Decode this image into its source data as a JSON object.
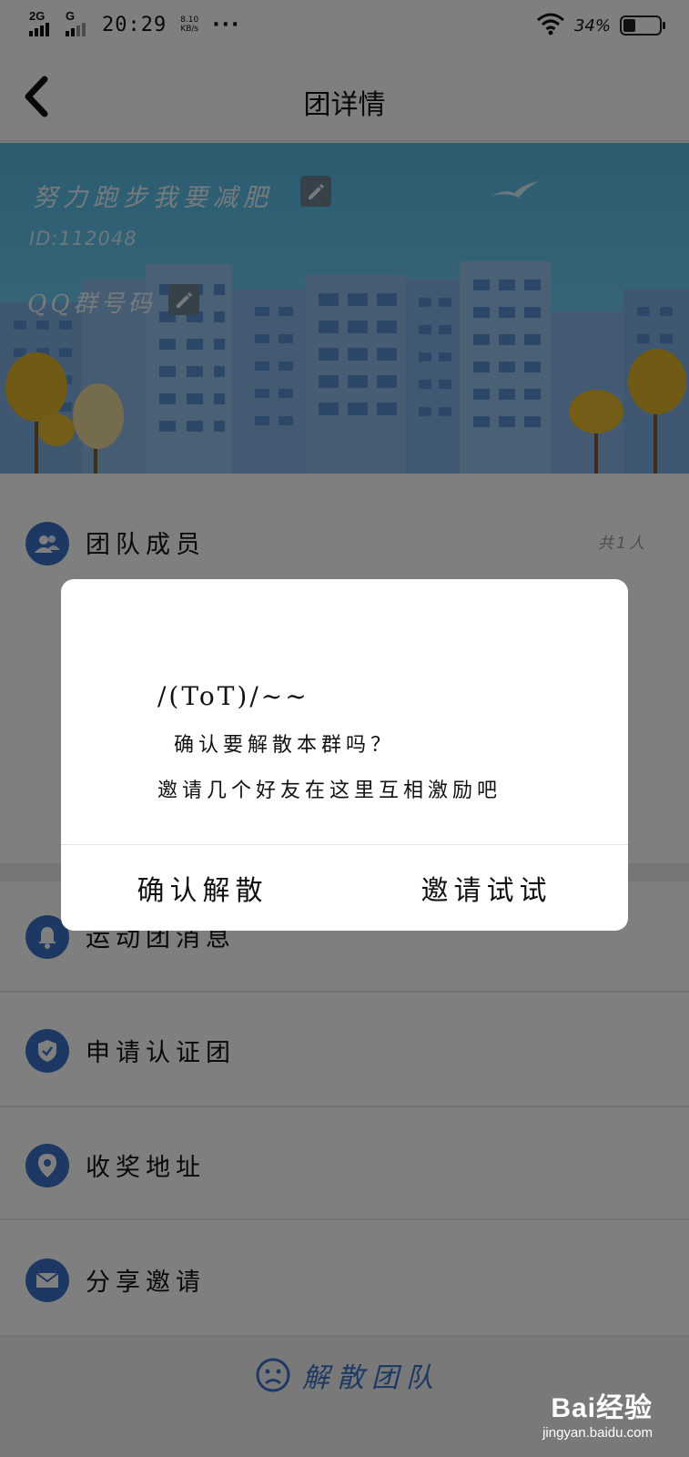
{
  "status_bar": {
    "network1": "2G",
    "network2": "G",
    "time": "20:29",
    "speed_value": "8.10",
    "speed_unit": "KB/s",
    "more": "···",
    "battery_text": "34%",
    "battery_level": 0.34
  },
  "header": {
    "title": "团详情"
  },
  "banner": {
    "team_name": "努力跑步我要减肥",
    "team_id": "ID:112048",
    "qq_label": "QQ群号码"
  },
  "members": {
    "label": "团队成员",
    "count": "共1人"
  },
  "menu": {
    "items": [
      {
        "label": "运动团消息",
        "icon": "bell-icon"
      },
      {
        "label": "申请认证团",
        "icon": "shield-icon"
      },
      {
        "label": "收奖地址",
        "icon": "location-icon"
      },
      {
        "label": "分享邀请",
        "icon": "mail-icon"
      }
    ]
  },
  "footer": {
    "disband_label": "解散团队"
  },
  "watermark": {
    "logo": "Bai经验",
    "url": "jingyan.baidu.com"
  },
  "dialog": {
    "emoticon": "/(ToT)/~~",
    "message_line1": "确认要解散本群吗？",
    "message_line2": "邀请几个好友在这里互相激励吧",
    "confirm_label": "确认解散",
    "invite_label": "邀请试试"
  },
  "colors": {
    "accent": "#3a73c7",
    "overlay": "rgba(0,0,0,0.5)"
  }
}
